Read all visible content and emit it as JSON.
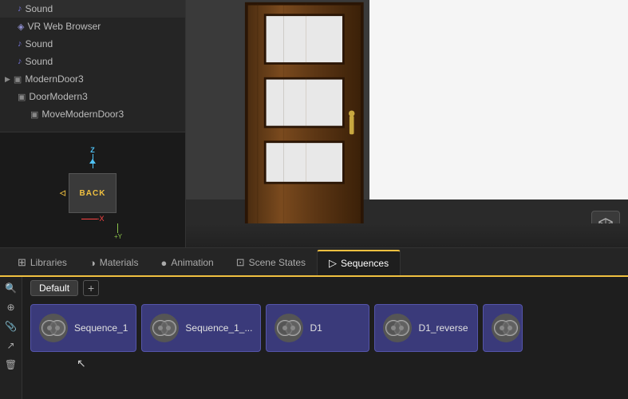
{
  "leftPanel": {
    "treeItems": [
      {
        "id": "sound1",
        "label": "Sound",
        "indent": 1,
        "type": "sound"
      },
      {
        "id": "vrweb",
        "label": "VR Web Browser",
        "indent": 1,
        "type": "vr"
      },
      {
        "id": "sound2",
        "label": "Sound",
        "indent": 1,
        "type": "sound"
      },
      {
        "id": "sound3",
        "label": "Sound",
        "indent": 1,
        "type": "sound"
      },
      {
        "id": "moderndoor3",
        "label": "ModernDoor3",
        "indent": 0,
        "type": "mesh"
      },
      {
        "id": "doormodern3",
        "label": "DoorModern3",
        "indent": 1,
        "type": "mesh"
      },
      {
        "id": "movemoddern3",
        "label": "MoveModernDoor3",
        "indent": 2,
        "type": "mesh"
      }
    ]
  },
  "preview": {
    "label": "BACK",
    "axisZ": "Z",
    "axisX": "-X"
  },
  "tabs": [
    {
      "id": "libraries",
      "label": "Libraries",
      "icon": "⊞",
      "active": false
    },
    {
      "id": "materials",
      "label": "Materials",
      "icon": "◑",
      "active": false
    },
    {
      "id": "animation",
      "label": "Animation",
      "icon": "●",
      "active": false
    },
    {
      "id": "scenestates",
      "label": "Scene States",
      "icon": "⊡",
      "active": false
    },
    {
      "id": "sequences",
      "label": "Sequences",
      "icon": "▷",
      "active": true
    }
  ],
  "sequences": {
    "defaultTab": "Default",
    "addTabLabel": "+",
    "cards": [
      {
        "id": "seq1",
        "label": "Sequence_1"
      },
      {
        "id": "seq1_",
        "label": "Sequence_1_..."
      },
      {
        "id": "d1",
        "label": "D1"
      },
      {
        "id": "d1rev",
        "label": "D1_reverse"
      },
      {
        "id": "partial",
        "label": ""
      }
    ]
  },
  "viewport": {
    "btn3d": "3D"
  },
  "leftTools": [
    "🔍",
    "⊕",
    "📎",
    "↗",
    "🗑"
  ],
  "cursor": "↖"
}
